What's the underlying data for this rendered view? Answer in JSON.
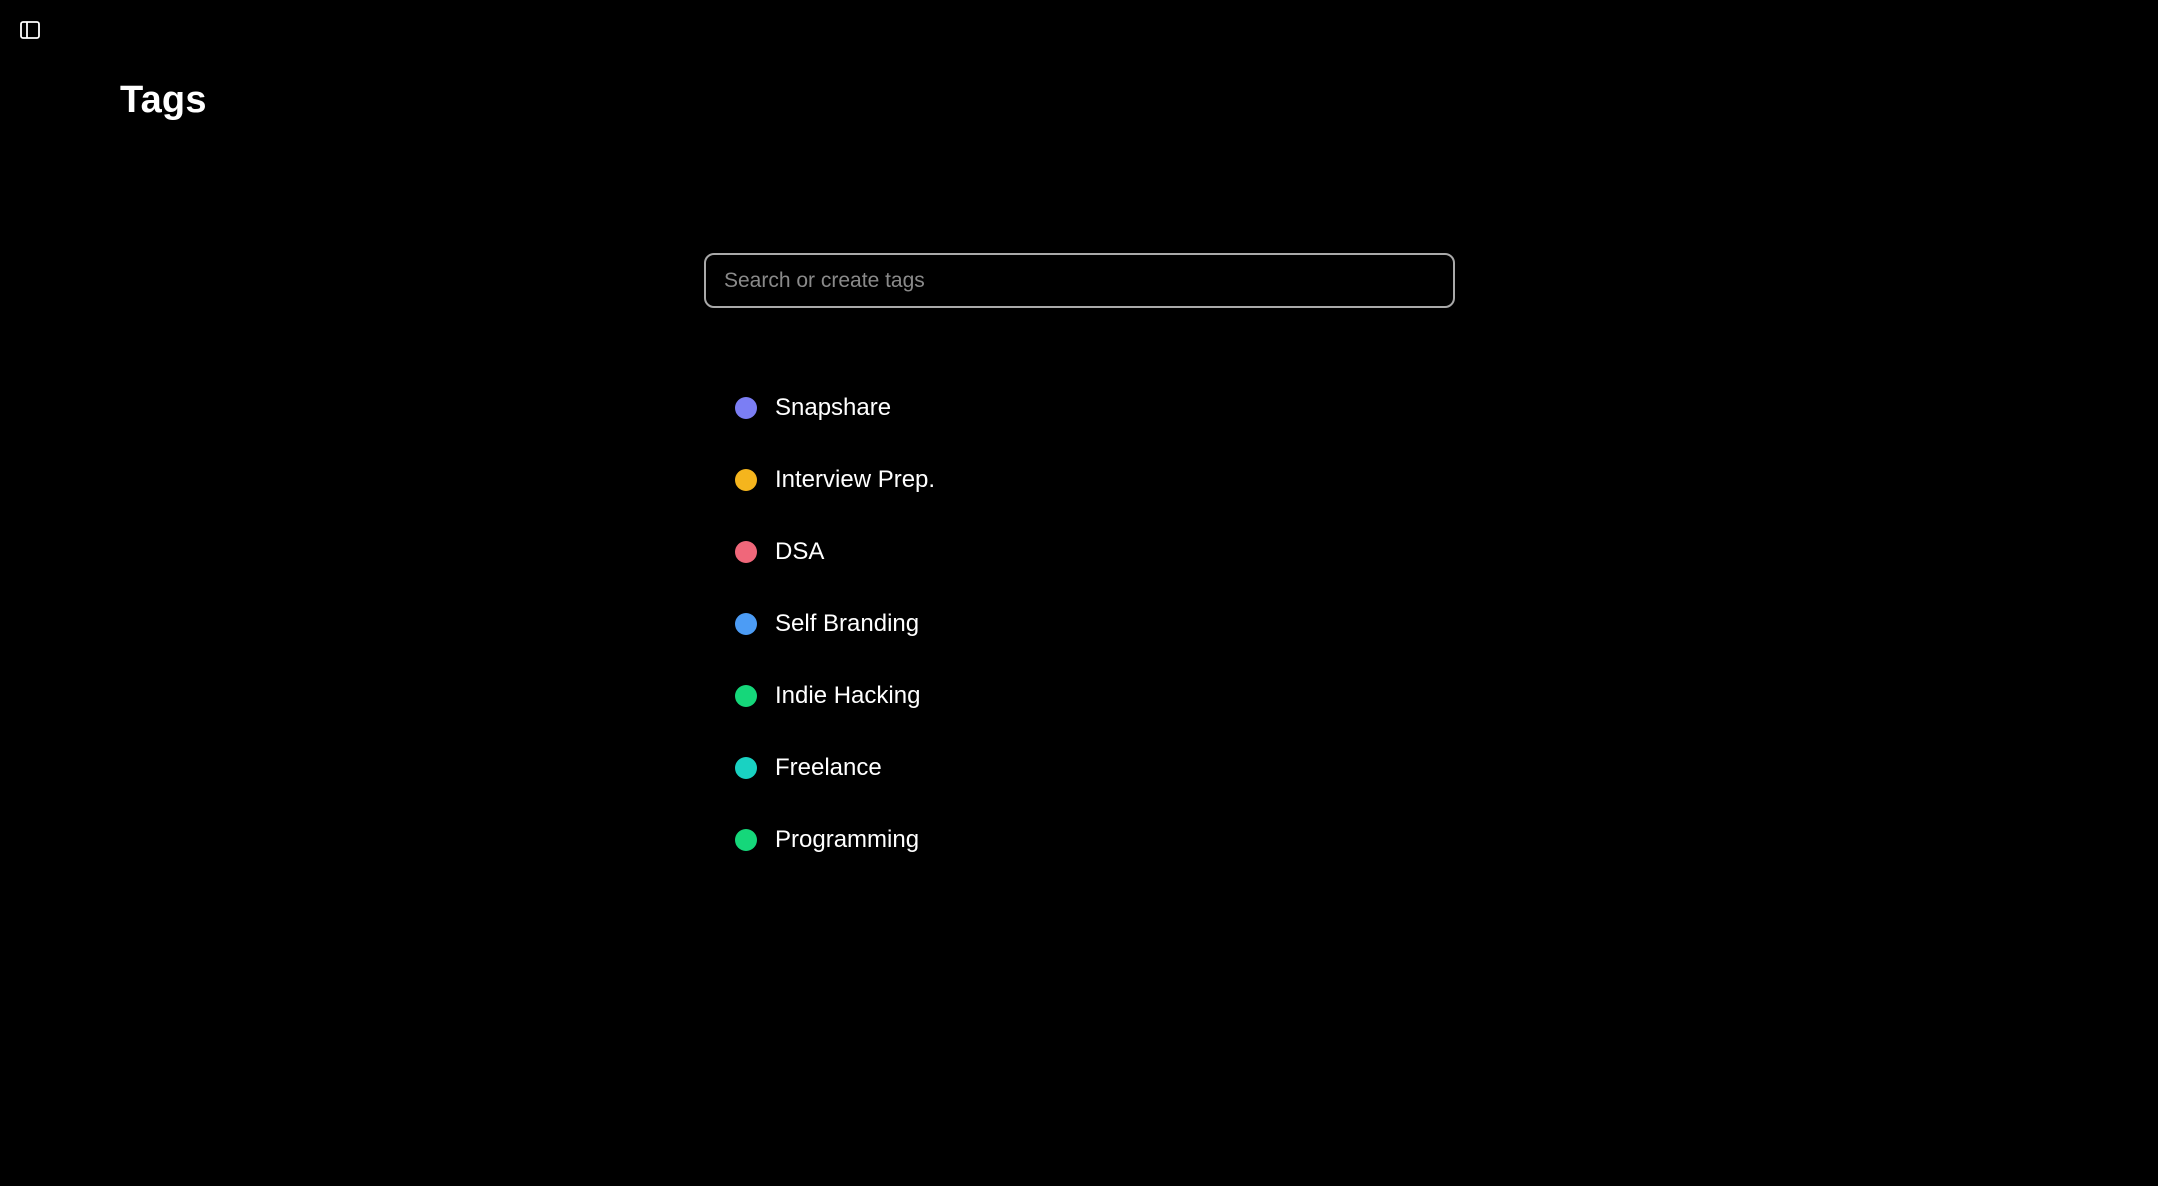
{
  "header": {
    "sidebar_toggle_icon": "sidebar-panel-icon",
    "title": "Tags"
  },
  "search": {
    "placeholder": "Search or create tags",
    "value": ""
  },
  "tags": [
    {
      "label": "Snapshare",
      "color": "#7b7ef4"
    },
    {
      "label": "Interview Prep.",
      "color": "#f5b51d"
    },
    {
      "label": "DSA",
      "color": "#f0677a"
    },
    {
      "label": "Self Branding",
      "color": "#4c9cf5"
    },
    {
      "label": "Indie Hacking",
      "color": "#15d77a"
    },
    {
      "label": "Freelance",
      "color": "#19d2c2"
    },
    {
      "label": "Programming",
      "color": "#15d77a"
    }
  ]
}
